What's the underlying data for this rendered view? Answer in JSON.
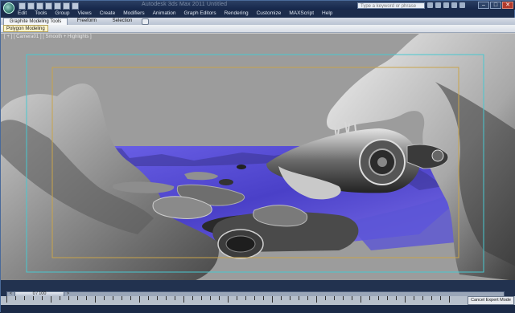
{
  "window": {
    "title": "Autodesk 3ds Max 2011    Untitled",
    "search_placeholder": "Type a keyword or phrase",
    "minimize": "–",
    "maximize": "□",
    "close": "✕"
  },
  "menu": [
    "Edit",
    "Tools",
    "Group",
    "Views",
    "Create",
    "Modifiers",
    "Animation",
    "Graph Editors",
    "Rendering",
    "Customize",
    "MAXScript",
    "Help"
  ],
  "ribbon": {
    "tabs": [
      "Graphite Modeling Tools",
      "Freeform",
      "Selection"
    ],
    "panel_label": "Polygon Modeling"
  },
  "viewport": {
    "label": "[ + ] [ Camera01 ] [ Smooth + Highlights ]"
  },
  "timeline": {
    "frame_display": "0 / 100",
    "prev_arrow": "<",
    "next_arrow": ">"
  },
  "status": {
    "cancel_expert_mode": "Cancel Expert Mode"
  },
  "colors": {
    "viewport_background": "#9c9c9c",
    "water": "#5a4fd8",
    "safe_frame_outer": "#48c8d0",
    "safe_frame_inner": "#c9a44a"
  }
}
